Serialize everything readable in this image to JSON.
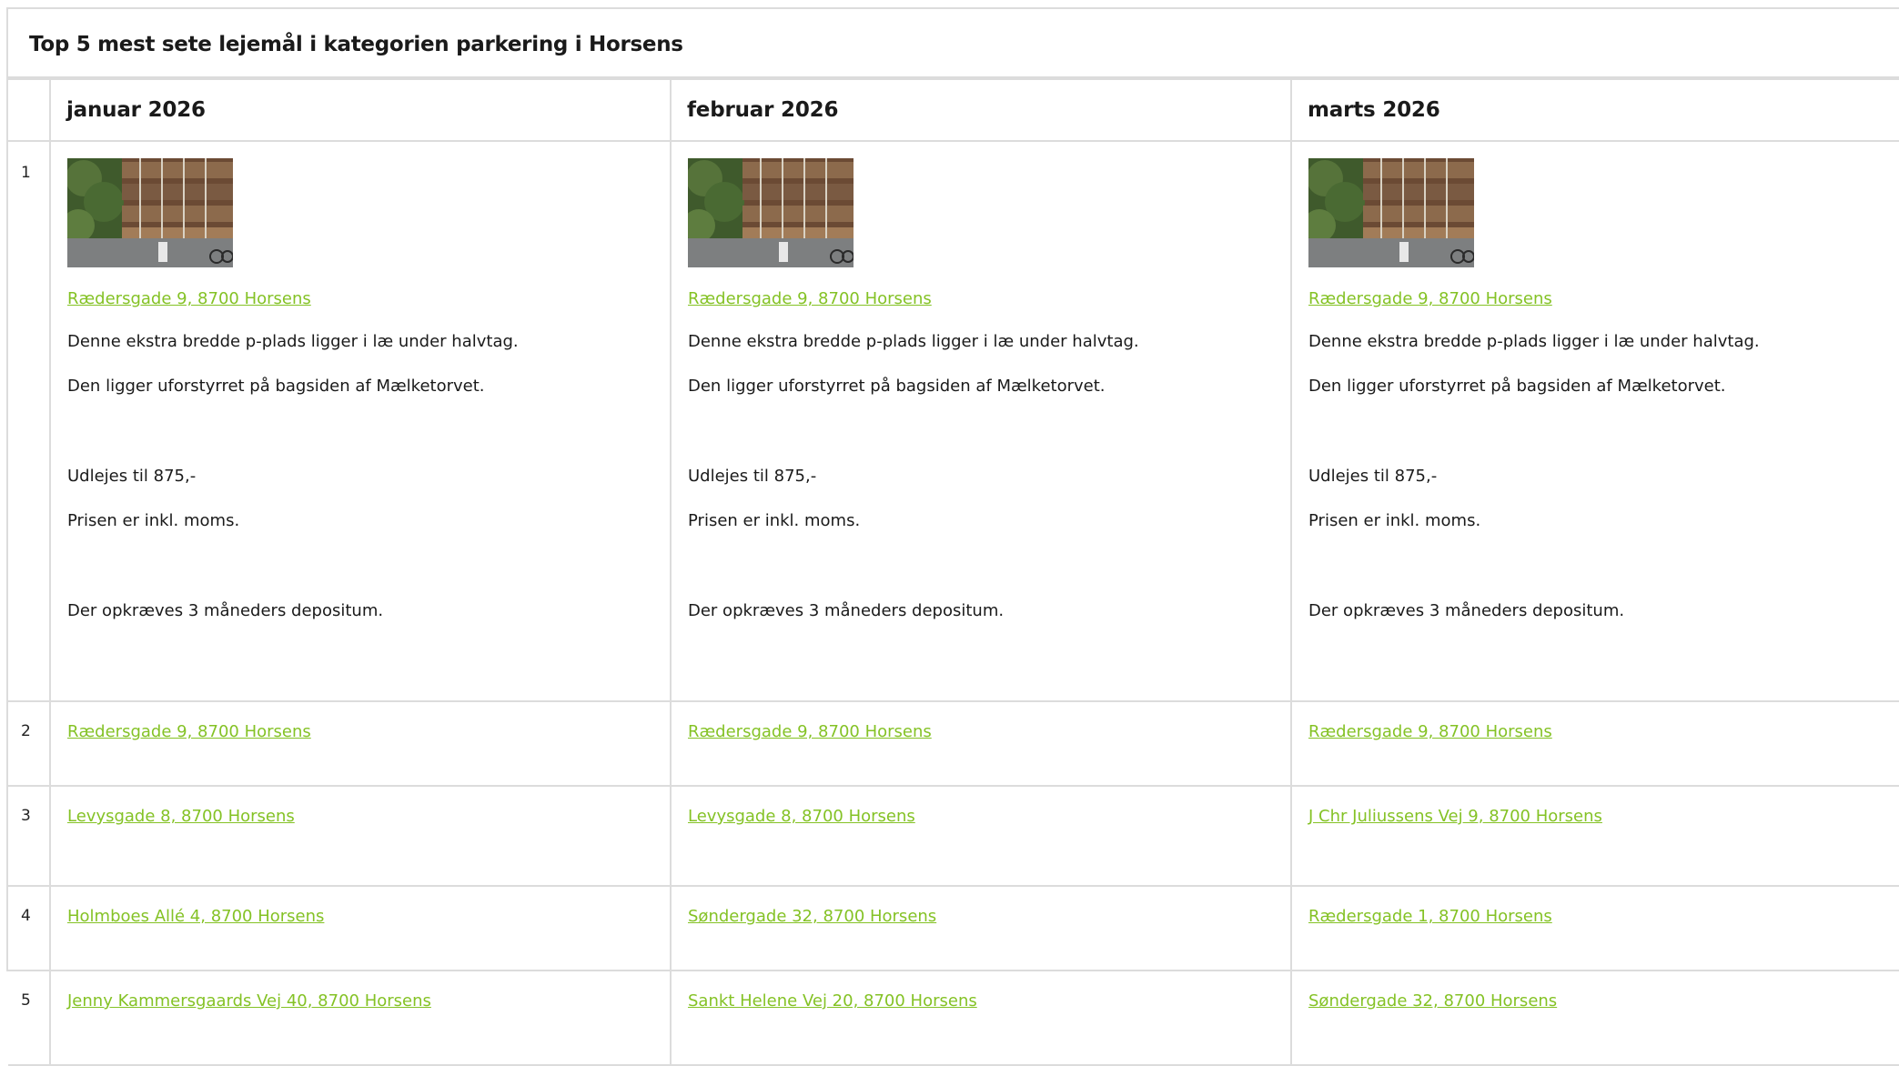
{
  "title": "Top 5 mest sete lejemål i kategorien parkering i Horsens",
  "months": [
    "januar 2026",
    "februar 2026",
    "marts 2026"
  ],
  "featured": {
    "rank": "1",
    "address": "Rædersgade 9, 8700 Horsens",
    "lines": [
      "Denne ekstra bredde p-plads ligger i læ under halvtag.",
      "Den ligger uforstyrret på bagsiden af Mælketorvet.",
      "",
      "Udlejes til 875,-",
      "Prisen er inkl. moms.",
      "",
      "Der opkræves 3 måneders depositum."
    ]
  },
  "rows": [
    {
      "rank": "2",
      "cells": [
        "Rædersgade 9, 8700 Horsens",
        "Rædersgade 9, 8700 Horsens",
        "Rædersgade 9, 8700 Horsens"
      ]
    },
    {
      "rank": "3",
      "cells": [
        "Levysgade 8, 8700 Horsens",
        "Levysgade 8, 8700 Horsens",
        "J Chr Juliussens Vej 9, 8700 Horsens"
      ]
    },
    {
      "rank": "4",
      "cells": [
        "Holmboes Allé 4, 8700 Horsens",
        "Søndergade 32, 8700 Horsens",
        "Rædersgade 1, 8700 Horsens"
      ]
    },
    {
      "rank": "5",
      "cells": [
        "Jenny Kammersgaards Vej 40, 8700 Horsens",
        "Sankt Helene Vej 20, 8700 Horsens",
        "Søndergade 32, 8700 Horsens"
      ]
    }
  ],
  "colors": {
    "link": "#84c225",
    "border": "#dcdcdc"
  }
}
